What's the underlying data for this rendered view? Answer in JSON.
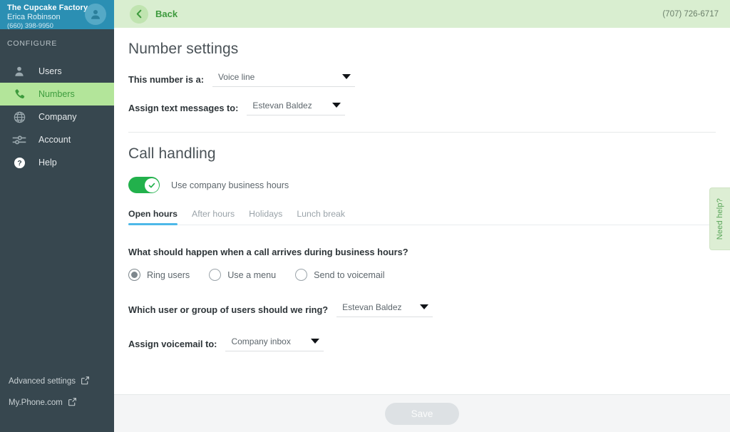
{
  "sidebar": {
    "org_name": "The Cupcake Factory",
    "user_name": "Erica Robinson",
    "user_phone": "(660) 398-9950",
    "section_label": "CONFIGURE",
    "items": [
      {
        "label": "Users",
        "icon": "user-icon",
        "active": false
      },
      {
        "label": "Numbers",
        "icon": "phone-icon",
        "active": true
      },
      {
        "label": "Company",
        "icon": "globe-icon",
        "active": false
      },
      {
        "label": "Account",
        "icon": "sliders-icon",
        "active": false
      },
      {
        "label": "Help",
        "icon": "question-circle-icon",
        "active": false
      }
    ],
    "links": [
      {
        "label": "Advanced settings"
      },
      {
        "label": "My.Phone.com"
      }
    ]
  },
  "topbar": {
    "back_label": "Back",
    "phone_number": "(707) 726-6717"
  },
  "number_settings": {
    "title": "Number settings",
    "number_type_label": "This number is a:",
    "number_type_value": "Voice line",
    "text_messages_label": "Assign text messages to:",
    "text_messages_value": "Estevan Baldez"
  },
  "call_handling": {
    "title": "Call handling",
    "business_hours_toggle_label": "Use company business hours",
    "business_hours_toggle_on": true,
    "tabs": [
      {
        "label": "Open hours",
        "active": true
      },
      {
        "label": "After hours",
        "active": false
      },
      {
        "label": "Holidays",
        "active": false
      },
      {
        "label": "Lunch break",
        "active": false
      }
    ],
    "question": "What should happen when a call arrives during business hours?",
    "options": [
      {
        "label": "Ring users",
        "selected": true
      },
      {
        "label": "Use a menu",
        "selected": false
      },
      {
        "label": "Send to voicemail",
        "selected": false
      }
    ],
    "ring_label": "Which user or group of users should we ring?",
    "ring_value": "Estevan Baldez",
    "voicemail_label": "Assign voicemail to:",
    "voicemail_value": "Company inbox"
  },
  "need_help": {
    "label": "Need help?"
  },
  "footer": {
    "save_label": "Save"
  },
  "colors": {
    "sidebar_bg": "#37474f",
    "sidebar_header": "#2b8fb3",
    "active_nav": "#b3e59a",
    "accent_green": "#3d9a3d",
    "topbar_bg": "#d9eed0",
    "toggle_on": "#22b14c",
    "tab_underline": "#4db8e8"
  }
}
